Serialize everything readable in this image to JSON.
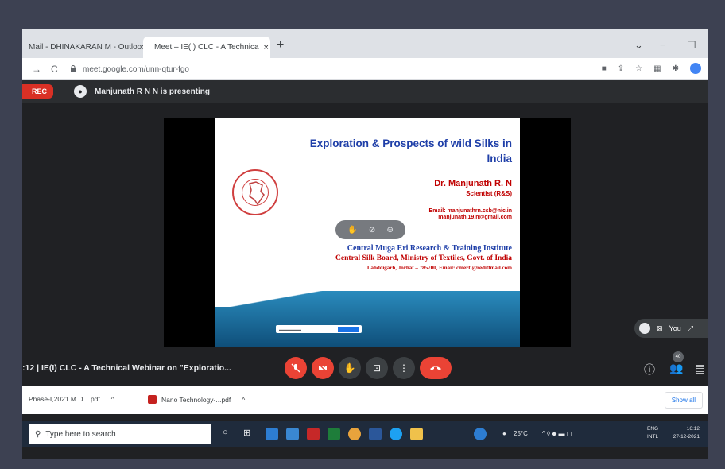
{
  "browser": {
    "tabs": [
      {
        "label": "Mail - DHINAKARAN M - Outloo",
        "close": "×"
      },
      {
        "label": "Meet – IE(I) CLC - A Technica",
        "close": "×"
      }
    ],
    "new_tab": "+",
    "window_controls": {
      "dropdown": "⌄",
      "minimize": "−",
      "maximize": "☐"
    },
    "nav": {
      "back": "←",
      "forward": "→",
      "reload": "C"
    },
    "url": "meet.google.com/unn-qtur-fgo"
  },
  "meet": {
    "rec_label": "REC",
    "presenter_text": "Manjunath R N N is presenting",
    "self_label": "You",
    "meeting_title": ":12  |  IE(I) CLC - A Technical Webinar on \"Exploratio...",
    "participant_count": "40"
  },
  "slide": {
    "title_line1": "Exploration & Prospects of wild Silks in",
    "title_line2": "India",
    "presenter_name": "Dr. Manjunath R. N",
    "presenter_role": "Scientist (R&S)",
    "email_line1": "Email: manjunathrn.csb@nic.in",
    "email_line2": "manjunath.19.n@gmail.com",
    "institute": "Central Muga Eri Research & Training Institute",
    "board": "Central Silk Board, Ministry of Textiles, Govt. of India",
    "address": "Lahdoigarh, Jorhat – 785700,  Email: cmerti@rediffmail.com"
  },
  "downloads": {
    "items": [
      {
        "label": "Phase-I,2021 M.D....pdf"
      },
      {
        "label": "Nano Technology-...pdf"
      }
    ],
    "show_all": "Show all"
  },
  "taskbar": {
    "search_placeholder": "Type here to search",
    "temperature": "25°C",
    "lang_line1": "ENG",
    "lang_line2": "INTL",
    "time": "16:12",
    "date": "27-12-2021"
  },
  "colors": {
    "meet_red": "#ea4335",
    "slide_blue": "#1f3fa8",
    "slide_red": "#c00000",
    "taskbar": "#1f2b3c"
  }
}
